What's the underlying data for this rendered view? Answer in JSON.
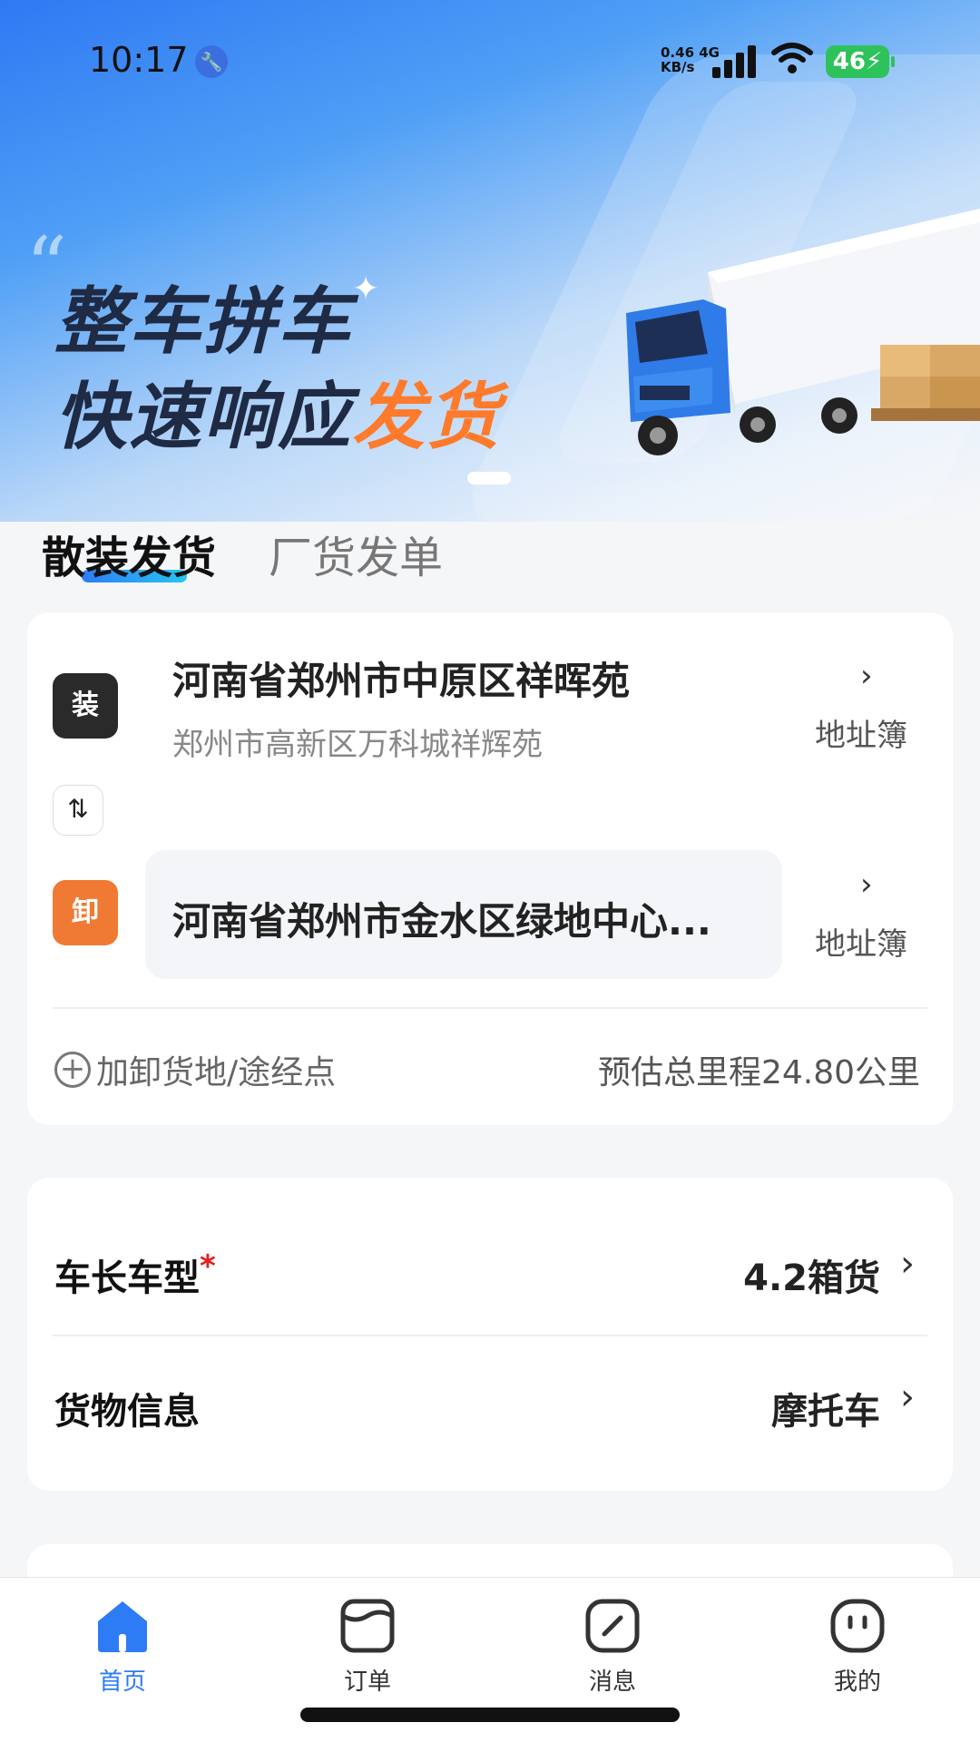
{
  "status_bar": {
    "time": "10:17",
    "net_speed_value": "0.46",
    "net_speed_unit": "KB/s",
    "network": "4G",
    "battery": "46"
  },
  "banner": {
    "line1": "整车拼车",
    "line2_main": "快速响应",
    "line2_highlight": "发货",
    "highlight_color": "#ff7a2a"
  },
  "tabs": {
    "active": "散装发货",
    "inactive": "厂货发单"
  },
  "address": {
    "load_badge": "装",
    "load_main": "河南省郑州市中原区祥晖苑",
    "load_sub": "郑州市高新区万科城祥辉苑",
    "unload_badge": "卸",
    "unload_main": "河南省郑州市金水区绿地中心...",
    "address_book": "地址簿",
    "add_stop": "加卸货地/途经点",
    "distance": "预估总里程24.80公里"
  },
  "vehicle": {
    "type_label": "车长车型",
    "required_mark": "*",
    "type_value": "4.2箱货",
    "cargo_label": "货物信息",
    "cargo_value": "摩托车"
  },
  "nav": {
    "home": "首页",
    "orders": "订单",
    "messages": "消息",
    "mine": "我的",
    "active_color": "#2d7cf6"
  }
}
